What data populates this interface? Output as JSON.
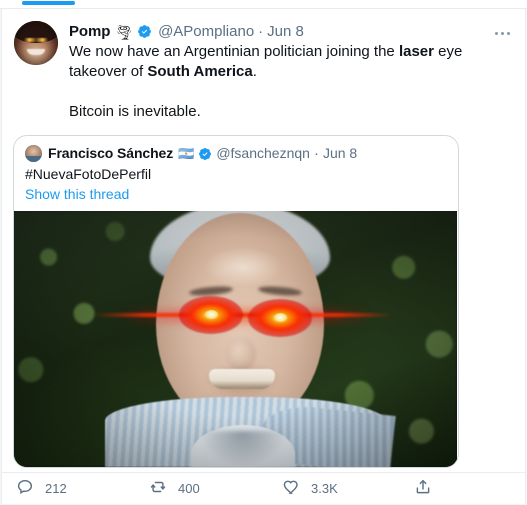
{
  "tab": {
    "indicator_color": "#1d9bf0"
  },
  "tweet": {
    "author": {
      "display_name": "Pomp",
      "emoji": "🌪",
      "verified_badge": "verified-badge",
      "handle": "@APompliano",
      "separator": "·",
      "date": "Jun 8"
    },
    "more_menu": "more-options",
    "text": {
      "line1_a": "We now have an Argentinian politician joining the ",
      "line1_bold": "laser",
      "line1_b": " eye takeover of ",
      "line2_bold": "South America",
      "line2_b": ".",
      "paragraph2": "Bitcoin is inevitable."
    }
  },
  "quoted_tweet": {
    "author": {
      "display_name": "Francisco Sánchez",
      "flag": "🇦🇷",
      "verified_badge": "verified-badge",
      "handle": "@fsancheznqn",
      "separator": "·",
      "date": "Jun 8"
    },
    "text": "#NuevaFotoDePerfil",
    "show_thread_label": "Show this thread",
    "media": {
      "alt": "man with gray hair smiling, red laser eyes, striped light blue shirt, green foliage background"
    }
  },
  "actions": {
    "reply": {
      "icon": "reply-icon",
      "count": "212"
    },
    "retweet": {
      "icon": "retweet-icon",
      "count": "400"
    },
    "like": {
      "icon": "heart-icon",
      "count": "3.3K"
    },
    "share": {
      "icon": "share-icon"
    }
  },
  "colors": {
    "link": "#1d9bf0",
    "muted_text": "#5b7083",
    "primary_text": "#0f1419",
    "border": "#cfd9de",
    "laser": "#ff2a00"
  }
}
